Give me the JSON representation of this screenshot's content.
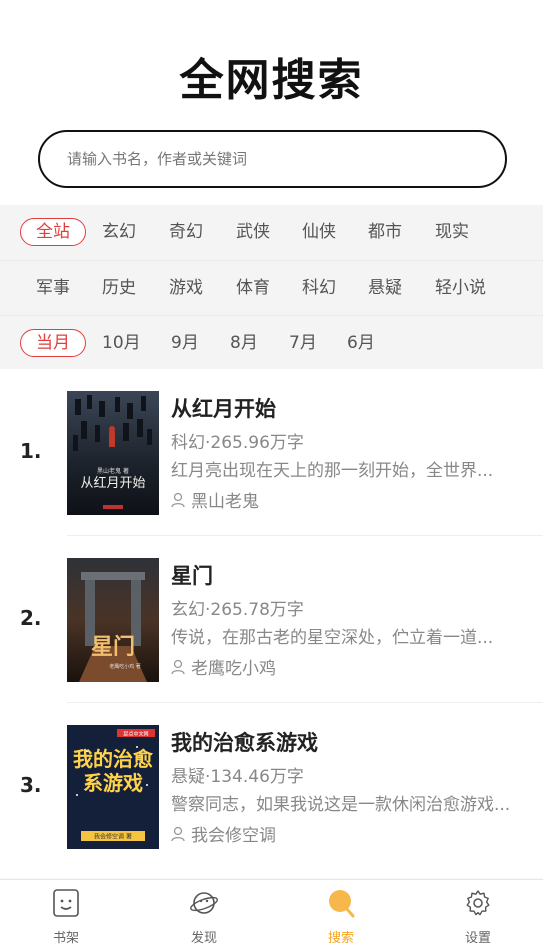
{
  "header": {
    "title": "全网搜索"
  },
  "search": {
    "placeholder": "请输入书名，作者或关键词"
  },
  "categories": {
    "row1": [
      "全站",
      "玄幻",
      "奇幻",
      "武侠",
      "仙侠",
      "都市",
      "现实"
    ],
    "row2": [
      "军事",
      "历史",
      "游戏",
      "体育",
      "科幻",
      "悬疑",
      "轻小说"
    ],
    "selected": "全站"
  },
  "periods": {
    "items": [
      "当月",
      "10月",
      "9月",
      "8月",
      "7月",
      "6月"
    ],
    "selected": "当月"
  },
  "books": [
    {
      "rank": "1.",
      "title": "从红月开始",
      "meta": "科幻·265.96万字",
      "desc": "红月亮出现在天上的那一刻开始，全世界...",
      "author": "黑山老鬼",
      "cover_text": "从红月开始",
      "cover_subtitle": "黑山老鬼 著"
    },
    {
      "rank": "2.",
      "title": "星门",
      "meta": "玄幻·265.78万字",
      "desc": "传说，在那古老的星空深处，伫立着一道...",
      "author": "老鹰吃小鸡",
      "cover_text": "星门",
      "cover_subtitle": "老鹰吃小鸡 著"
    },
    {
      "rank": "3.",
      "title": "我的治愈系游戏",
      "meta": "悬疑·134.46万字",
      "desc": "警察同志，如果我说这是一款休闲治愈游戏...",
      "author": "我会修空调",
      "cover_text": "我的治愈系游戏",
      "cover_subtitle": "我会修空调 著",
      "cover_brand": "起点中文网"
    }
  ],
  "tabs": [
    {
      "label": "书架",
      "icon": "bookshelf-icon"
    },
    {
      "label": "发现",
      "icon": "discover-planet-icon"
    },
    {
      "label": "搜索",
      "icon": "search-icon"
    },
    {
      "label": "设置",
      "icon": "gear-icon"
    }
  ],
  "active_tab": "搜索",
  "colors": {
    "accent_red": "#e23e3e",
    "active_tab": "#f5a623",
    "filter_bg": "#f4f4f5",
    "muted_text": "#888888"
  }
}
